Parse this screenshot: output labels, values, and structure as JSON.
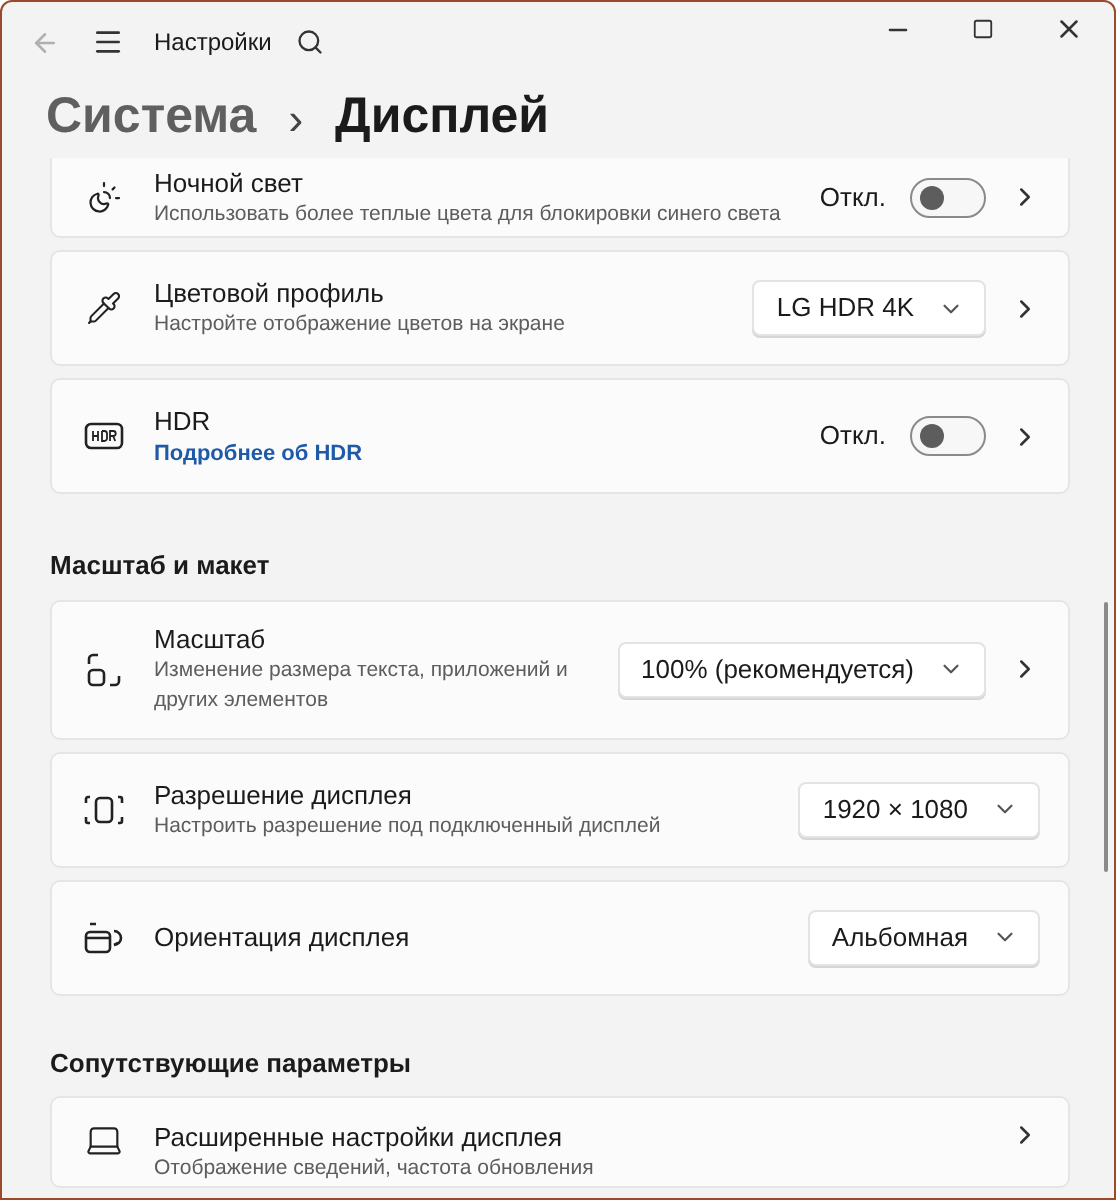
{
  "titlebar": {
    "app_title": "Настройки"
  },
  "breadcrumb": {
    "parent": "Система",
    "separator": "›",
    "current": "Дисплей"
  },
  "sections": [
    {
      "items": [
        {
          "title": "Ночной свет",
          "subtitle": "Использовать более теплые цвета для блокировки синего света",
          "kind": "toggle",
          "state_label": "Откл.",
          "on": false,
          "chevron": true
        },
        {
          "title": "Цветовой профиль",
          "subtitle": "Настройте отображение цветов на экране",
          "kind": "dropdown",
          "value": "LG HDR 4K",
          "chevron": true
        },
        {
          "title": "HDR",
          "link": "Подробнее об HDR",
          "kind": "toggle",
          "state_label": "Откл.",
          "on": false,
          "chevron": true
        }
      ]
    },
    {
      "heading": "Масштаб и макет",
      "items": [
        {
          "title": "Масштаб",
          "subtitle": "Изменение размера текста, приложений и других элементов",
          "kind": "dropdown",
          "value": "100% (рекомендуется)",
          "chevron": true
        },
        {
          "title": "Разрешение дисплея",
          "subtitle": "Настроить разрешение под подключенный дисплей",
          "kind": "dropdown",
          "value": "1920 × 1080",
          "chevron": false
        },
        {
          "title": "Ориентация дисплея",
          "kind": "dropdown",
          "value": "Альбомная",
          "chevron": false
        }
      ]
    },
    {
      "heading": "Сопутствующие параметры",
      "items": [
        {
          "title": "Расширенные настройки дисплея",
          "subtitle": "Отображение сведений, частота обновления",
          "kind": "none",
          "chevron": true
        }
      ]
    }
  ]
}
